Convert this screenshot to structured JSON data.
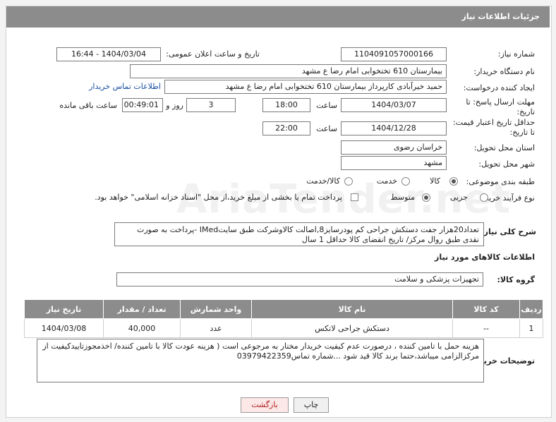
{
  "title": "جزئیات اطلاعات نیاز",
  "fields": {
    "need_number_label": "شماره نیاز:",
    "need_number": "1104091057000166",
    "announce_label": "تاریخ و ساعت اعلان عمومی:",
    "announce_value": "1404/03/04 - 16:44",
    "buyer_label": "نام دستگاه خریدار:",
    "buyer_value": "بیمارستان 610 تختخوابی امام رضا ع  مشهد",
    "requester_label": "ایجاد کننده درخواست:",
    "requester_value": "حمید خیرآبادی کارپرداز بیمارستان 610 تختخوابی امام رضا ع  مشهد",
    "contact_link": "اطلاعات تماس خریدار",
    "deadline_label_1": "مهلت ارسال پاسخ: تا",
    "deadline_label_2": "تاریخ:",
    "deadline_date": "1404/03/07",
    "time_label": "ساعت",
    "deadline_time": "18:00",
    "days_value": "3",
    "days_label": "روز و",
    "remaining_time": "00:49:01",
    "remaining_label": "ساعت باقی مانده",
    "validity_label_1": "حداقل تاریخ اعتبار قیمت:",
    "validity_label_2": "تا تاریخ:",
    "validity_date": "1404/12/28",
    "validity_time": "22:00",
    "province_label": "استان محل تحویل:",
    "province_value": "خراسان رضوی",
    "city_label": "شهر محل تحویل:",
    "city_value": "مشهد",
    "category_label": "طبقه بندی موضوعی:",
    "category_options": [
      "کالا",
      "خدمت",
      "کالا/خدمت"
    ],
    "process_label": "نوع فرآیند خرید :",
    "process_options": [
      "جزیی",
      "متوسط"
    ],
    "payment_note": "پرداخت تمام یا بخشی از مبلغ خرید،از محل \"اسناد خزانه اسلامی\" خواهد بود."
  },
  "description": {
    "label": "شرح کلی نیاز:",
    "text": "تعداد20هزار جفت دستکش جراحی کم پودرسایز8,اصالت کالاوشرکت طبق سایتIMed -پرداخت به صورت نقدی طبق روال مرکز/ تاریخ انقضای کالا حداقل 1 سال"
  },
  "goods_section": {
    "heading": "اطلاعات کالاهای مورد نیاز",
    "group_label": "گروه کالا:",
    "group_value": "تجهیزات پزشکی و سلامت"
  },
  "table": {
    "headers": [
      "ردیف",
      "کد کالا",
      "نام کالا",
      "واحد شمارش",
      "تعداد / مقدار",
      "تاریخ نیاز"
    ],
    "rows": [
      [
        "1",
        "--",
        "دستکش جراحی لاتکس",
        "عدد",
        "40,000",
        "1404/03/08"
      ]
    ]
  },
  "buyer_notes": {
    "label": "توضیحات خریدار:",
    "text": "هزینه حمل با تامین کننده ، درصورت عدم کیفیت خریدار مختار به مرجوعی است ( هزینه عودت کالا با تامین کننده/ اخذمجوزتاییدکیفیت از مرکزالزامی میباشد،حتما برند کالا قید شود ...شماره تماس03979422359"
  },
  "buttons": {
    "back": "بازگشت",
    "print": "چاپ"
  },
  "watermark": "AriaTender.net"
}
